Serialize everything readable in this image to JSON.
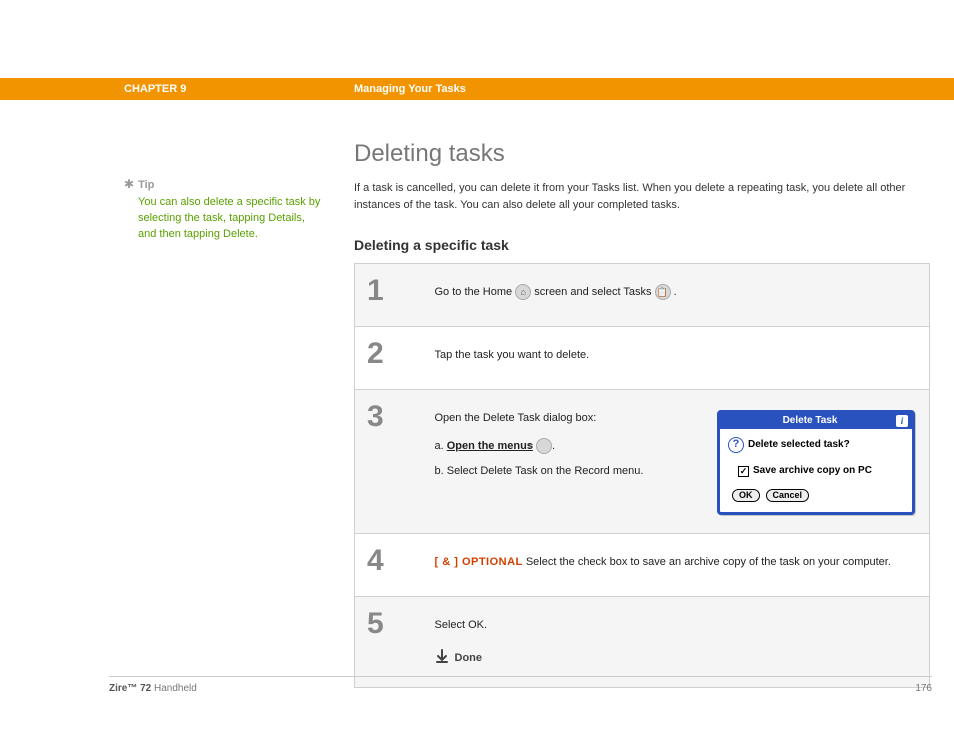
{
  "header": {
    "chapter": "CHAPTER 9",
    "title": "Managing Your Tasks"
  },
  "sidebar": {
    "tip_label": "Tip",
    "tip_text": "You can also delete a specific task by selecting the task, tapping Details, and then tapping Delete."
  },
  "main": {
    "h1": "Deleting tasks",
    "intro": "If a task is cancelled, you can delete it from your Tasks list. When you delete a repeating task, you delete all other instances of the task. You can also delete all your completed tasks.",
    "h2": "Deleting a specific task"
  },
  "steps": {
    "s1": {
      "num": "1",
      "pre": "Go to the Home ",
      "mid": " screen and select Tasks ",
      "post": "."
    },
    "s2": {
      "num": "2",
      "text": "Tap the task you want to delete."
    },
    "s3": {
      "num": "3",
      "lead": "Open the Delete Task dialog box:",
      "a_prefix": "a.  ",
      "a_link": "Open the menus",
      "a_post": " ",
      "b": "b.  Select Delete Task on the Record menu."
    },
    "s4": {
      "num": "4",
      "tag": "[ & ]  OPTIONAL",
      "text": "   Select the check box to save an archive copy of the task on your computer."
    },
    "s5": {
      "num": "5",
      "text": "Select OK.",
      "done": "Done"
    }
  },
  "dialog": {
    "title": "Delete Task",
    "question": "Delete selected task?",
    "archive": "Save archive copy on PC",
    "check": "✓",
    "ok": "OK",
    "cancel": "Cancel"
  },
  "footer": {
    "product_bold": "Zire™ 72",
    "product_rest": " Handheld",
    "page": "176"
  }
}
